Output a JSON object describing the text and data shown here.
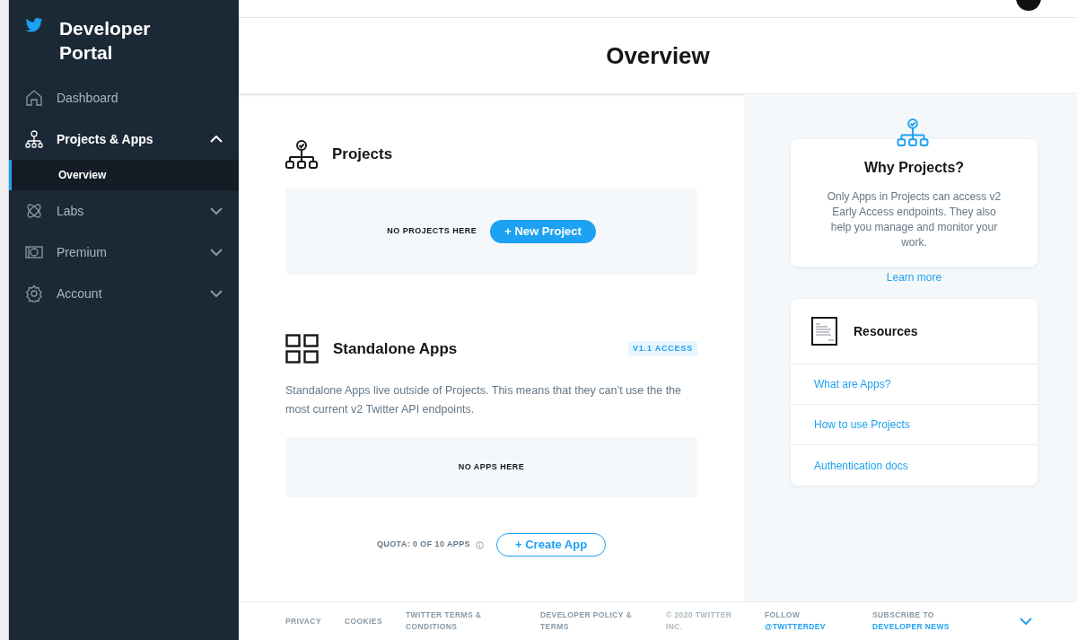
{
  "sidebar": {
    "title": "Developer Portal",
    "items": [
      {
        "label": "Dashboard",
        "kind": "link"
      },
      {
        "label": "Projects & Apps",
        "kind": "group",
        "expanded": true,
        "children": [
          {
            "label": "Overview",
            "selected": true
          }
        ]
      },
      {
        "label": "Labs",
        "kind": "group",
        "expanded": false
      },
      {
        "label": "Premium",
        "kind": "group",
        "expanded": false
      },
      {
        "label": "Account",
        "kind": "group",
        "expanded": false
      }
    ]
  },
  "header": {
    "title": "Overview"
  },
  "projects": {
    "title": "Projects",
    "empty_text": "NO PROJECTS HERE",
    "button": "+ New Project"
  },
  "standalone": {
    "title": "Standalone Apps",
    "badge": "V1.1 ACCESS",
    "description": "Standalone Apps live outside of Projects. This means that they can’t use the the most current v2 Twitter API endpoints.",
    "empty_text": "NO APPS HERE",
    "quota": "QUOTA: 0 OF 10 APPS",
    "button": "+ Create App"
  },
  "why_projects": {
    "title": "Why Projects?",
    "text": "Only Apps in Projects can access v2 Early Access endpoints. They also help you manage and monitor your work.",
    "link": "Learn more"
  },
  "resources": {
    "title": "Resources",
    "links": [
      "What are Apps?",
      "How to use Projects",
      "Authentication docs"
    ]
  },
  "footer": [
    {
      "kind": "text",
      "text": "PRIVACY"
    },
    {
      "kind": "text",
      "text": "COOKIES"
    },
    {
      "kind": "text",
      "text": "TWITTER TERMS & CONDITIONS"
    },
    {
      "kind": "text",
      "text": "DEVELOPER POLICY & TERMS"
    },
    {
      "kind": "muted",
      "text": "© 2020 TWITTER INC."
    },
    {
      "kind": "mixed",
      "text": "FOLLOW",
      "link": "@TWITTERDEV"
    },
    {
      "kind": "mixed",
      "text": "SUBSCRIBE TO",
      "link": "DEVELOPER NEWS"
    }
  ]
}
